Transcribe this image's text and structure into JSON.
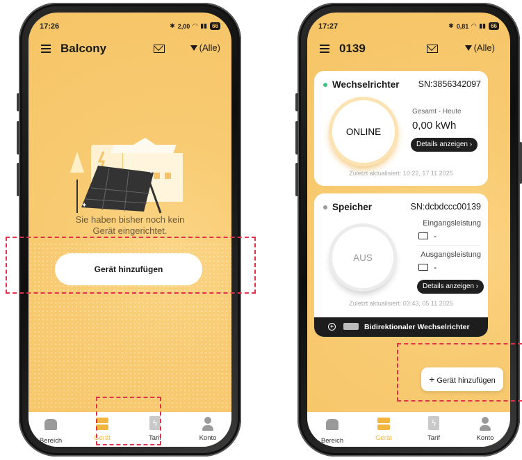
{
  "left": {
    "status": {
      "time": "17:26",
      "net": "2,00",
      "battery": "66"
    },
    "header": {
      "title": "Balcony",
      "filter": "(Alle)"
    },
    "empty_text": [
      "Sie haben bisher noch kein",
      "Gerät eingerichtet."
    ],
    "add_device_label": "Gerät hinzufügen"
  },
  "right": {
    "status": {
      "time": "17:27",
      "net": "0,81",
      "battery": "66"
    },
    "header": {
      "title": "0139",
      "filter": "(Alle)"
    },
    "inverter": {
      "title": "Wechselrichter",
      "sn": "SN:3856342097",
      "status": "ONLINE",
      "total_label": "Gesamt - Heute",
      "total_value": "0,00 kWh",
      "details_label": "Details anzeigen",
      "updated": "Zuletzt aktualisiert: 10:22, 17 11 2025",
      "dot_color": "#3dc47e"
    },
    "storage": {
      "title": "Speicher",
      "sn": "SN:dcbdccc00139",
      "status": "AUS",
      "input_label": "Eingangsleistung",
      "input_value": "-",
      "output_label": "Ausgangsleistung",
      "output_value": "-",
      "details_label": "Details anzeigen",
      "updated": "Zuletzt aktualisiert: 03:43, 05 11 2025",
      "footer": "Bidirektionaler Wechselrichter",
      "dot_color": "#9a9a9a"
    },
    "add_device_label": "Gerät hinzufügen"
  },
  "nav": [
    "Bereich",
    "Gerät",
    "Tarif",
    "Konto"
  ],
  "colors": {
    "accent": "#f2b640",
    "highlight": "#e0324b"
  }
}
